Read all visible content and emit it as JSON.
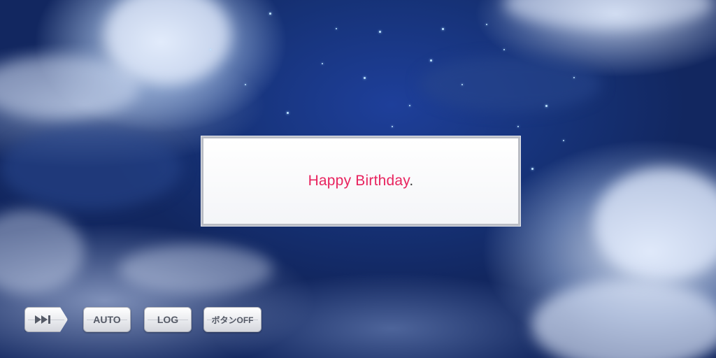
{
  "dialog": {
    "text": "Happy Birthday",
    "punctuation": "."
  },
  "controls": {
    "skip_icon": "skip-forward-icon",
    "auto_label": "AUTO",
    "log_label": "LOG",
    "buttons_off_label": "ボタンOFF"
  },
  "colors": {
    "dialog_text": "#e8245f",
    "sky": "#1a3a8c"
  }
}
